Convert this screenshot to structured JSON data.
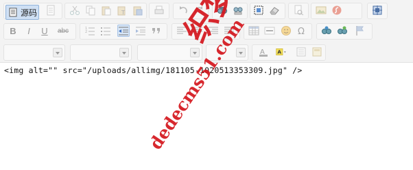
{
  "toolbar": {
    "source_button_label": "源码",
    "icons_row1": [
      "source-code-icon",
      "new-page-icon",
      "cut-icon",
      "copy-icon",
      "paste-icon",
      "paste-text-icon",
      "paste-word-icon",
      "print-icon",
      "undo-icon",
      "redo-icon",
      "find-icon",
      "replace-icon",
      "select-all-icon",
      "remove-format-icon",
      "preview-icon",
      "image-icon",
      "flash-icon",
      "maximize-icon"
    ],
    "icons_row2": [
      "bold-icon",
      "italic-icon",
      "underline-icon",
      "strike-icon",
      "numbered-list-icon",
      "bulleted-list-icon",
      "outdent-icon",
      "indent-icon",
      "blockquote-icon",
      "align-left-icon",
      "align-center-icon",
      "align-right-icon",
      "align-justify-icon",
      "table-icon",
      "horizontal-rule-icon",
      "smiley-icon",
      "special-char-icon",
      "link-icon",
      "unlink-icon",
      "anchor-icon"
    ],
    "bold_label": "B",
    "italic_label": "I",
    "underline_label": "U",
    "strike_label": "abc",
    "text_color_label": "A"
  },
  "content": {
    "source_text": "<img alt=\"\" src=\"/uploads/allimg/181105-1020513353309.jpg\" />"
  },
  "watermark": {
    "chinese_text": "织梦无忧",
    "site_text": "dedecms51.com"
  },
  "colors": {
    "toolbar_bg": "#f3f3f3",
    "source_button_bg": "#cfe0f4",
    "watermark": "#d4161d"
  }
}
